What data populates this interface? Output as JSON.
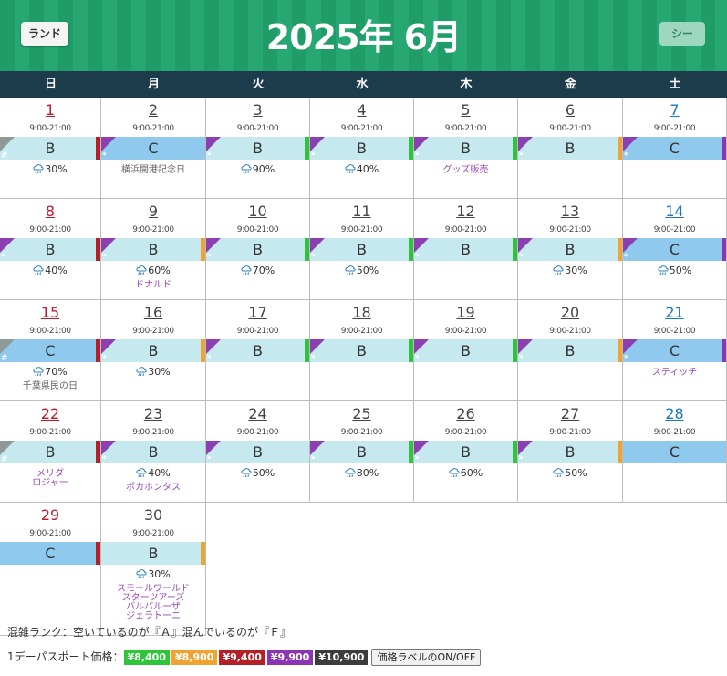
{
  "header": {
    "title": "2025年 6月",
    "land_button": "ランド",
    "sea_button": "シー"
  },
  "weekdays": [
    "日",
    "月",
    "火",
    "水",
    "木",
    "金",
    "土"
  ],
  "price_colors": {
    "8400": "#2fc53a",
    "8900": "#f0a232",
    "9400": "#b51f27",
    "9900": "#8b34b4",
    "10900": "#3c3c3c"
  },
  "days": [
    {
      "day": "1",
      "hours": "9:00-21:00",
      "rank": "B",
      "corner": "#",
      "price": "9400",
      "rain": "30%",
      "events": []
    },
    {
      "day": "2",
      "hours": "9:00-21:00",
      "rank": "C",
      "corner": "*",
      "price": "",
      "rain": "",
      "events": [
        {
          "text": "横浜開港記念日",
          "style": "gray"
        }
      ]
    },
    {
      "day": "3",
      "hours": "9:00-21:00",
      "rank": "B",
      "corner": "*",
      "price": "8400",
      "rain": "90%",
      "events": []
    },
    {
      "day": "4",
      "hours": "9:00-21:00",
      "rank": "B",
      "corner": "*",
      "price": "8400",
      "rain": "40%",
      "events": []
    },
    {
      "day": "5",
      "hours": "9:00-21:00",
      "rank": "B",
      "corner": "*",
      "price": "8400",
      "rain": "",
      "events": [
        {
          "text": "グッズ販売",
          "style": "purple"
        }
      ]
    },
    {
      "day": "6",
      "hours": "9:00-21:00",
      "rank": "B",
      "corner": "*",
      "price": "8900",
      "rain": "",
      "events": []
    },
    {
      "day": "7",
      "hours": "9:00-21:00",
      "rank": "C",
      "corner": "*",
      "price": "9900",
      "rain": "",
      "events": []
    },
    {
      "day": "8",
      "hours": "9:00-21:00",
      "rank": "B",
      "corner": "*",
      "price": "9400",
      "rain": "40%",
      "events": []
    },
    {
      "day": "9",
      "hours": "9:00-21:00",
      "rank": "B",
      "corner": "*",
      "price": "8900",
      "rain": "60%",
      "events": [
        {
          "text": "ドナルド",
          "style": "purple"
        }
      ]
    },
    {
      "day": "10",
      "hours": "9:00-21:00",
      "rank": "B",
      "corner": "*",
      "price": "8400",
      "rain": "70%",
      "events": []
    },
    {
      "day": "11",
      "hours": "9:00-21:00",
      "rank": "B",
      "corner": "*",
      "price": "8400",
      "rain": "50%",
      "events": []
    },
    {
      "day": "12",
      "hours": "9:00-21:00",
      "rank": "B",
      "corner": "*",
      "price": "8400",
      "rain": "",
      "events": []
    },
    {
      "day": "13",
      "hours": "9:00-21:00",
      "rank": "B",
      "corner": "*",
      "price": "8900",
      "rain": "30%",
      "events": []
    },
    {
      "day": "14",
      "hours": "9:00-21:00",
      "rank": "C",
      "corner": "*",
      "price": "9900",
      "rain": "50%",
      "events": []
    },
    {
      "day": "15",
      "hours": "9:00-21:00",
      "rank": "C",
      "corner": "#",
      "price": "9400",
      "rain": "70%",
      "events": [
        {
          "text": "千葉県民の日",
          "style": "gray"
        }
      ]
    },
    {
      "day": "16",
      "hours": "9:00-21:00",
      "rank": "B",
      "corner": "*",
      "price": "8900",
      "rain": "30%",
      "events": []
    },
    {
      "day": "17",
      "hours": "9:00-21:00",
      "rank": "B",
      "corner": "*",
      "price": "8400",
      "rain": "",
      "events": []
    },
    {
      "day": "18",
      "hours": "9:00-21:00",
      "rank": "B",
      "corner": "*",
      "price": "8400",
      "rain": "",
      "events": []
    },
    {
      "day": "19",
      "hours": "9:00-21:00",
      "rank": "B",
      "corner": "*",
      "price": "8400",
      "rain": "",
      "events": []
    },
    {
      "day": "20",
      "hours": "9:00-21:00",
      "rank": "B",
      "corner": "*",
      "price": "8900",
      "rain": "",
      "events": []
    },
    {
      "day": "21",
      "hours": "9:00-21:00",
      "rank": "C",
      "corner": "*",
      "price": "9900",
      "rain": "",
      "events": [
        {
          "text": "スティッチ",
          "style": "purple"
        }
      ]
    },
    {
      "day": "22",
      "hours": "9:00-21:00",
      "rank": "B",
      "corner": "#",
      "price": "9400",
      "rain": "",
      "events": [
        {
          "text": "メリダ",
          "style": "purple"
        },
        {
          "text": "ロジャー",
          "style": "purple"
        }
      ]
    },
    {
      "day": "23",
      "hours": "9:00-21:00",
      "rank": "B",
      "corner": "*",
      "price": "",
      "rain": "40%",
      "events": [
        {
          "text": "ポカホンタス",
          "style": "purple"
        }
      ]
    },
    {
      "day": "24",
      "hours": "9:00-21:00",
      "rank": "B",
      "corner": "*",
      "price": "",
      "rain": "50%",
      "events": []
    },
    {
      "day": "25",
      "hours": "9:00-21:00",
      "rank": "B",
      "corner": "*",
      "price": "8400",
      "rain": "80%",
      "events": []
    },
    {
      "day": "26",
      "hours": "9:00-21:00",
      "rank": "B",
      "corner": "*",
      "price": "8400",
      "rain": "60%",
      "events": []
    },
    {
      "day": "27",
      "hours": "9:00-21:00",
      "rank": "B",
      "corner": "*",
      "price": "8900",
      "rain": "50%",
      "events": []
    },
    {
      "day": "28",
      "hours": "9:00-21:00",
      "rank": "C",
      "corner": "",
      "price": "",
      "rain": "",
      "events": []
    },
    {
      "day": "29",
      "hours": "9:00-21:00",
      "rank": "C",
      "corner": "",
      "price": "9400",
      "rain": "",
      "events": []
    },
    {
      "day": "30",
      "hours": "9:00-21:00",
      "rank": "B",
      "corner": "",
      "price": "8900",
      "rain": "30%",
      "events": [
        {
          "text": "スモールワールド",
          "style": "purple"
        },
        {
          "text": "スターツアーズ",
          "style": "purple"
        },
        {
          "text": "バルバルーザ",
          "style": "purple"
        },
        {
          "text": "ジェラトーニ",
          "style": "purple"
        }
      ]
    }
  ],
  "legend": {
    "crowd_text": "混雑ランク：空いているのが『Ａ』混んでいるのが『Ｆ』",
    "price_label": "1デーパスポート価格：",
    "prices": [
      {
        "label": "¥8,400",
        "color": "#2fc53a"
      },
      {
        "label": "¥8,900",
        "color": "#f0a232"
      },
      {
        "label": "¥9,400",
        "color": "#b51f27"
      },
      {
        "label": "¥9,900",
        "color": "#8b34b4"
      },
      {
        "label": "¥10,900",
        "color": "#3c3c3c"
      }
    ],
    "toggle_label": "価格ラベルのON/OFF"
  }
}
